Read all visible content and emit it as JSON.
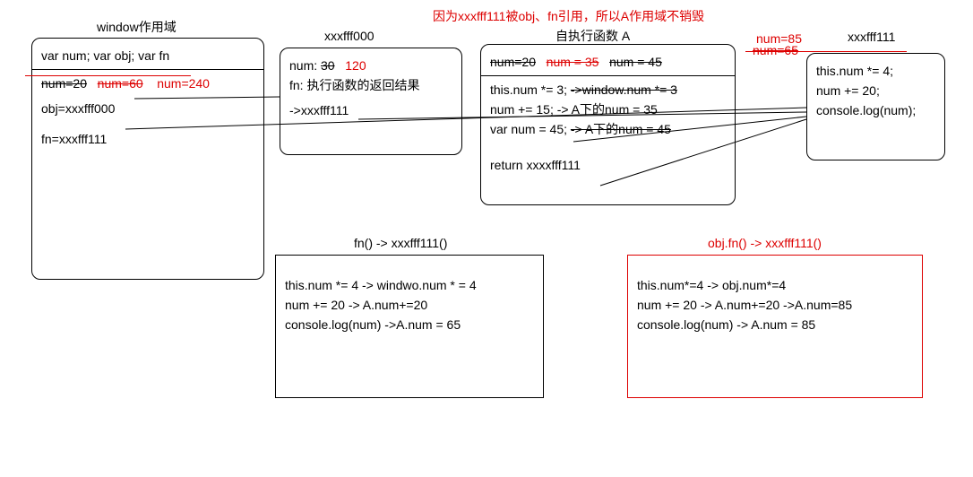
{
  "top_note": "因为xxxfff111被obj、fn引用，所以A作用域不销毁",
  "num85_label": "num=85",
  "num65_label": "num=65",
  "window_scope": {
    "title": "window作用域",
    "decl": "var num; var obj; var fn",
    "num20": "num=20",
    "num60": "num=60",
    "num240": "num=240",
    "obj_ref": "obj=xxxfff000",
    "fn_ref": "fn=xxxfff111"
  },
  "obj_box": {
    "title": "xxxfff000",
    "num_label": "num:",
    "num_old": "30",
    "num_new": "120",
    "fn_label": "fn: 执行函数的返回结果",
    "fn_arrow": "->xxxfff111"
  },
  "iife": {
    "title": "自执行函数 A",
    "num20": "num=20",
    "num35": "num = 35",
    "num45": "num = 45",
    "l1a": "this.num *= 3;",
    "l1b": "->window.num  *= 3",
    "l2": "num += 15;  -> A下的num = 35",
    "l3a": "var num = 45;",
    "l3b": "-> A下的num = 45",
    "ret": "return xxxxfff111"
  },
  "fn111": {
    "title": "xxxfff111",
    "l1": "this.num *= 4;",
    "l2": "num += 20;",
    "l3": "console.log(num);"
  },
  "fn_call": {
    "title": "fn() -> xxxfff111()",
    "l1": "this.num *= 4 -> windwo.num * = 4",
    "l2": "num += 20 -> A.num+=20",
    "l3": "console.log(num) ->A.num = 65"
  },
  "obj_call": {
    "title": "obj.fn() -> xxxfff111()",
    "l1": "this.num*=4 -> obj.num*=4",
    "l2": "num += 20 -> A.num+=20  ->A.num=85",
    "l3": "console.log(num) -> A.num = 85"
  }
}
